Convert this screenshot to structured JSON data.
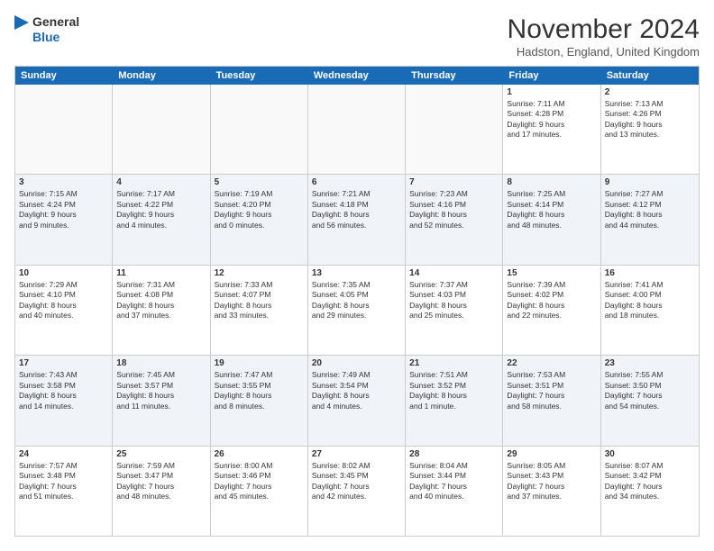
{
  "logo": {
    "line1": "General",
    "line2": "Blue"
  },
  "title": "November 2024",
  "location": "Hadston, England, United Kingdom",
  "weekdays": [
    "Sunday",
    "Monday",
    "Tuesday",
    "Wednesday",
    "Thursday",
    "Friday",
    "Saturday"
  ],
  "rows": [
    [
      {
        "day": "",
        "info": "",
        "empty": true
      },
      {
        "day": "",
        "info": "",
        "empty": true
      },
      {
        "day": "",
        "info": "",
        "empty": true
      },
      {
        "day": "",
        "info": "",
        "empty": true
      },
      {
        "day": "",
        "info": "",
        "empty": true
      },
      {
        "day": "1",
        "info": "Sunrise: 7:11 AM\nSunset: 4:28 PM\nDaylight: 9 hours\nand 17 minutes."
      },
      {
        "day": "2",
        "info": "Sunrise: 7:13 AM\nSunset: 4:26 PM\nDaylight: 9 hours\nand 13 minutes."
      }
    ],
    [
      {
        "day": "3",
        "info": "Sunrise: 7:15 AM\nSunset: 4:24 PM\nDaylight: 9 hours\nand 9 minutes."
      },
      {
        "day": "4",
        "info": "Sunrise: 7:17 AM\nSunset: 4:22 PM\nDaylight: 9 hours\nand 4 minutes."
      },
      {
        "day": "5",
        "info": "Sunrise: 7:19 AM\nSunset: 4:20 PM\nDaylight: 9 hours\nand 0 minutes."
      },
      {
        "day": "6",
        "info": "Sunrise: 7:21 AM\nSunset: 4:18 PM\nDaylight: 8 hours\nand 56 minutes."
      },
      {
        "day": "7",
        "info": "Sunrise: 7:23 AM\nSunset: 4:16 PM\nDaylight: 8 hours\nand 52 minutes."
      },
      {
        "day": "8",
        "info": "Sunrise: 7:25 AM\nSunset: 4:14 PM\nDaylight: 8 hours\nand 48 minutes."
      },
      {
        "day": "9",
        "info": "Sunrise: 7:27 AM\nSunset: 4:12 PM\nDaylight: 8 hours\nand 44 minutes."
      }
    ],
    [
      {
        "day": "10",
        "info": "Sunrise: 7:29 AM\nSunset: 4:10 PM\nDaylight: 8 hours\nand 40 minutes."
      },
      {
        "day": "11",
        "info": "Sunrise: 7:31 AM\nSunset: 4:08 PM\nDaylight: 8 hours\nand 37 minutes."
      },
      {
        "day": "12",
        "info": "Sunrise: 7:33 AM\nSunset: 4:07 PM\nDaylight: 8 hours\nand 33 minutes."
      },
      {
        "day": "13",
        "info": "Sunrise: 7:35 AM\nSunset: 4:05 PM\nDaylight: 8 hours\nand 29 minutes."
      },
      {
        "day": "14",
        "info": "Sunrise: 7:37 AM\nSunset: 4:03 PM\nDaylight: 8 hours\nand 25 minutes."
      },
      {
        "day": "15",
        "info": "Sunrise: 7:39 AM\nSunset: 4:02 PM\nDaylight: 8 hours\nand 22 minutes."
      },
      {
        "day": "16",
        "info": "Sunrise: 7:41 AM\nSunset: 4:00 PM\nDaylight: 8 hours\nand 18 minutes."
      }
    ],
    [
      {
        "day": "17",
        "info": "Sunrise: 7:43 AM\nSunset: 3:58 PM\nDaylight: 8 hours\nand 14 minutes."
      },
      {
        "day": "18",
        "info": "Sunrise: 7:45 AM\nSunset: 3:57 PM\nDaylight: 8 hours\nand 11 minutes."
      },
      {
        "day": "19",
        "info": "Sunrise: 7:47 AM\nSunset: 3:55 PM\nDaylight: 8 hours\nand 8 minutes."
      },
      {
        "day": "20",
        "info": "Sunrise: 7:49 AM\nSunset: 3:54 PM\nDaylight: 8 hours\nand 4 minutes."
      },
      {
        "day": "21",
        "info": "Sunrise: 7:51 AM\nSunset: 3:52 PM\nDaylight: 8 hours\nand 1 minute."
      },
      {
        "day": "22",
        "info": "Sunrise: 7:53 AM\nSunset: 3:51 PM\nDaylight: 7 hours\nand 58 minutes."
      },
      {
        "day": "23",
        "info": "Sunrise: 7:55 AM\nSunset: 3:50 PM\nDaylight: 7 hours\nand 54 minutes."
      }
    ],
    [
      {
        "day": "24",
        "info": "Sunrise: 7:57 AM\nSunset: 3:48 PM\nDaylight: 7 hours\nand 51 minutes."
      },
      {
        "day": "25",
        "info": "Sunrise: 7:59 AM\nSunset: 3:47 PM\nDaylight: 7 hours\nand 48 minutes."
      },
      {
        "day": "26",
        "info": "Sunrise: 8:00 AM\nSunset: 3:46 PM\nDaylight: 7 hours\nand 45 minutes."
      },
      {
        "day": "27",
        "info": "Sunrise: 8:02 AM\nSunset: 3:45 PM\nDaylight: 7 hours\nand 42 minutes."
      },
      {
        "day": "28",
        "info": "Sunrise: 8:04 AM\nSunset: 3:44 PM\nDaylight: 7 hours\nand 40 minutes."
      },
      {
        "day": "29",
        "info": "Sunrise: 8:05 AM\nSunset: 3:43 PM\nDaylight: 7 hours\nand 37 minutes."
      },
      {
        "day": "30",
        "info": "Sunrise: 8:07 AM\nSunset: 3:42 PM\nDaylight: 7 hours\nand 34 minutes."
      }
    ]
  ]
}
